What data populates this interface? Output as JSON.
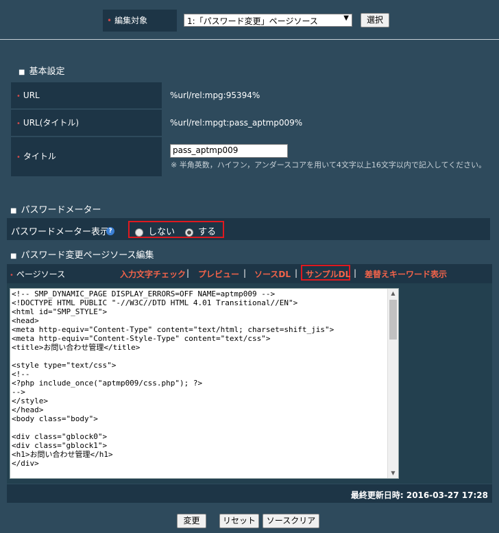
{
  "header": {
    "edit_target_label": "編集対象",
    "edit_target_value": "1:「パスワード変更」ページソース",
    "select_button": "選択"
  },
  "basic": {
    "section_title": "基本設定",
    "url_label": "URL",
    "url_value": "%url/rel:mpg:95394%",
    "url_title_label": "URL(タイトル)",
    "url_title_value": "%url/rel:mpgt:pass_aptmp009%",
    "title_label": "タイトル",
    "title_input_value": "pass_aptmp009",
    "title_note": "※ 半角英数，ハイフン，アンダースコアを用いて4文字以上16文字以内で記入してください。"
  },
  "meter": {
    "section_title": "パスワードメーター",
    "display_label": "パスワードメーター表示",
    "help_icon": "?",
    "option_off": "しない",
    "option_on": "する",
    "selected": "する"
  },
  "source": {
    "section_title": "パスワード変更ページソース編集",
    "page_source_label": "ページソース",
    "links": {
      "input_check": "入力文字チェック",
      "preview": "プレビュー",
      "source_dl": "ソースDL",
      "sample_dl": "サンプルDL",
      "keyword_display": "差替えキーワード表示"
    },
    "code": "<!-- SMP_DYNAMIC_PAGE DISPLAY_ERRORS=OFF NAME=aptmp009 -->\n<!DOCTYPE HTML PUBLIC \"-//W3C//DTD HTML 4.01 Transitional//EN\">\n<html id=\"SMP_STYLE\">\n<head>\n<meta http-equiv=\"Content-Type\" content=\"text/html; charset=shift_jis\">\n<meta http-equiv=\"Content-Style-Type\" content=\"text/css\">\n<title>お問い合わせ管理</title>\n\n<style type=\"text/css\">\n<!--\n<?php include_once(\"aptmp009/css.php\"); ?>\n-->\n</style>\n</head>\n<body class=\"body\">\n\n<div class=\"gblock0\">\n<div class=\"gblock1\">\n<h1>お問い合わせ管理</h1>\n</div>",
    "last_updated": "最終更新日時: 2016-03-27 17:28"
  },
  "actions": {
    "change": "変更",
    "reset": "リセット",
    "source_clear": "ソースクリア"
  },
  "colors": {
    "background": "#2e4a5c",
    "label_bg": "#1d3546",
    "link": "#f2634a",
    "highlight_border": "#e0191f"
  }
}
